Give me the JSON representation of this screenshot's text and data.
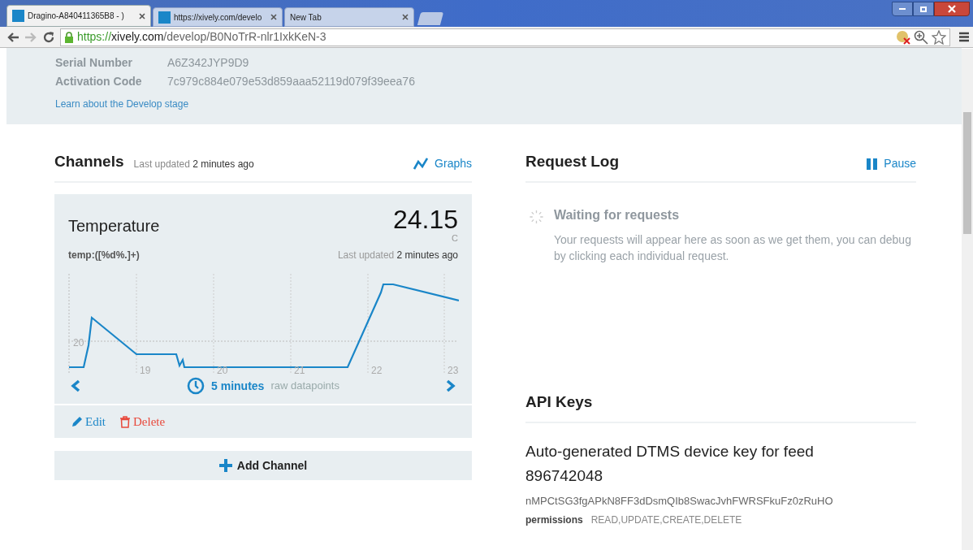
{
  "browser": {
    "tabs": [
      {
        "title": "Dragino-A840411365B8 - )",
        "selected": true,
        "favicon": true
      },
      {
        "title": "https://xively.com/develo",
        "selected": false,
        "favicon": true
      },
      {
        "title": "New Tab",
        "selected": false,
        "favicon": false
      }
    ],
    "url": {
      "scheme": "https://",
      "host": "xively.com",
      "path": "/develop/B0NoTrR-nlr1IxkKeN-3"
    }
  },
  "device_info": {
    "rows": [
      {
        "label": "Serial Number",
        "value": "A6Z342JYP9D9"
      },
      {
        "label": "Activation Code",
        "value": "7c979c884e079e53d859aaa52119d079f39eea76"
      }
    ],
    "link": "Learn about the Develop stage"
  },
  "channels": {
    "title": "Channels",
    "updated_label": "Last updated",
    "updated_value": "2 minutes ago",
    "graphs_link": "Graphs",
    "items": [
      {
        "name": "Temperature",
        "value": "24.15",
        "unit": "C",
        "format": "temp:([%d%.]+)",
        "updated_label": "Last updated",
        "updated_value": "2 minutes ago",
        "graph": {
          "y_tick": "20",
          "x_ticks": [
            "19",
            "20",
            "21",
            "22",
            "23"
          ]
        },
        "interval": "5 minutes",
        "interval_note": "raw datapoints",
        "edit": "Edit",
        "delete": "Delete"
      }
    ],
    "add_button": "Add Channel"
  },
  "request_log": {
    "title": "Request Log",
    "pause": "Pause",
    "waiting_title": "Waiting for requests",
    "waiting_text": "Your requests will appear here as soon as we get them, you can debug by clicking each individual request."
  },
  "api_keys": {
    "title": "API Keys",
    "keys": [
      {
        "name": "Auto-generated DTMS device key for feed 896742048",
        "key": "nMPCtSG3fgAPkN8FF3dDsmQIb8SwacJvhFWRSFkuFz0zRuHO",
        "permissions_label": "permissions",
        "permissions": "READ,UPDATE,CREATE,DELETE"
      }
    ]
  }
}
